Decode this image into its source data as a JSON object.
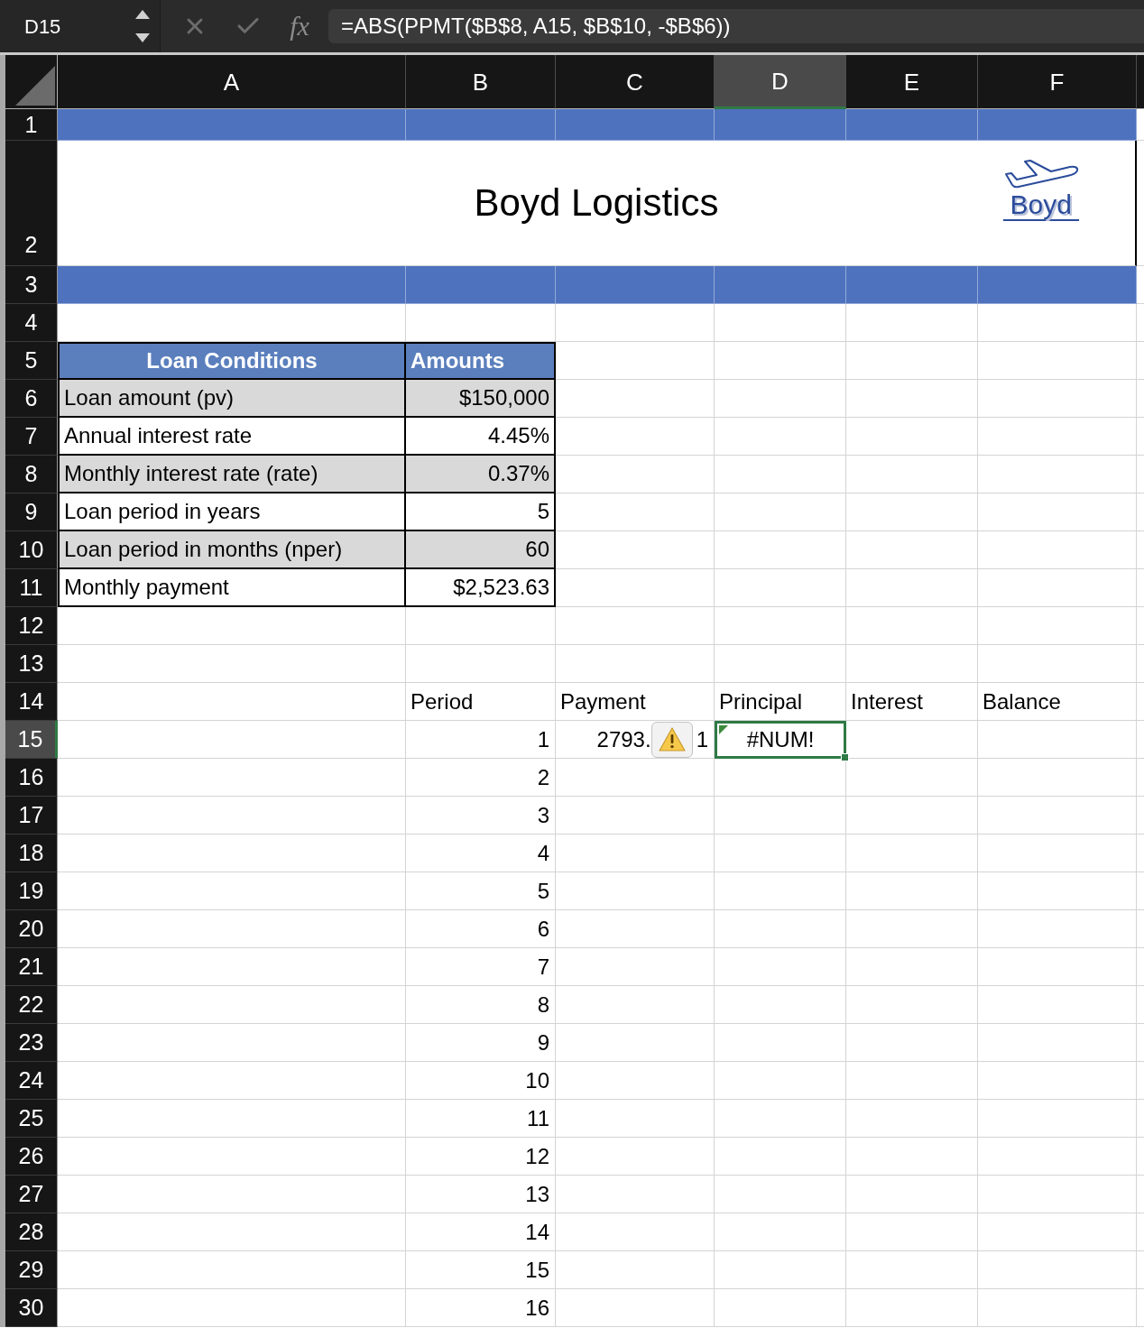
{
  "formula_bar": {
    "name_box": "D15",
    "function_label": "fx",
    "formula": "=ABS(PPMT($B$8, A15, $B$10, -$B$6))"
  },
  "columns": [
    {
      "label": "A",
      "selected": false
    },
    {
      "label": "B",
      "selected": false
    },
    {
      "label": "C",
      "selected": false
    },
    {
      "label": "D",
      "selected": true
    },
    {
      "label": "E",
      "selected": false
    },
    {
      "label": "F",
      "selected": false
    }
  ],
  "rows": [
    {
      "label": "1",
      "selected": false
    },
    {
      "label": "2",
      "selected": false
    },
    {
      "label": "3",
      "selected": false
    },
    {
      "label": "4",
      "selected": false
    },
    {
      "label": "5",
      "selected": false
    },
    {
      "label": "6",
      "selected": false
    },
    {
      "label": "7",
      "selected": false
    },
    {
      "label": "8",
      "selected": false
    },
    {
      "label": "9",
      "selected": false
    },
    {
      "label": "10",
      "selected": false
    },
    {
      "label": "11",
      "selected": false
    },
    {
      "label": "12",
      "selected": false
    },
    {
      "label": "13",
      "selected": false
    },
    {
      "label": "14",
      "selected": false
    },
    {
      "label": "15",
      "selected": true
    },
    {
      "label": "16",
      "selected": false
    },
    {
      "label": "17",
      "selected": false
    },
    {
      "label": "18",
      "selected": false
    },
    {
      "label": "19",
      "selected": false
    },
    {
      "label": "20",
      "selected": false
    },
    {
      "label": "21",
      "selected": false
    },
    {
      "label": "22",
      "selected": false
    },
    {
      "label": "23",
      "selected": false
    },
    {
      "label": "24",
      "selected": false
    },
    {
      "label": "25",
      "selected": false
    },
    {
      "label": "26",
      "selected": false
    },
    {
      "label": "27",
      "selected": false
    },
    {
      "label": "28",
      "selected": false
    },
    {
      "label": "29",
      "selected": false
    },
    {
      "label": "30",
      "selected": false
    }
  ],
  "title": "Boyd Logistics",
  "logo": {
    "text": "Boyd"
  },
  "loan_table": {
    "columns": [
      "Loan Conditions",
      "Amounts"
    ],
    "rows": [
      {
        "label": "Loan amount (pv)",
        "value": "$150,000"
      },
      {
        "label": "Annual interest rate",
        "value": "4.45%"
      },
      {
        "label": "Monthly interest rate (rate)",
        "value": "0.37%"
      },
      {
        "label": "Loan period in years",
        "value": "5"
      },
      {
        "label": "Loan period in months (nper)",
        "value": "60"
      },
      {
        "label": "Monthly payment",
        "value": "$2,523.63"
      }
    ]
  },
  "schedule": {
    "columns": [
      "Period",
      "Payment",
      "Principal",
      "Interest",
      "Balance"
    ],
    "rows": [
      {
        "period": "1",
        "payment": "2793.",
        "payment_tail": "1",
        "warning": true,
        "principal": "#NUM!",
        "error_flag": true
      },
      {
        "period": "2"
      },
      {
        "period": "3"
      },
      {
        "period": "4"
      },
      {
        "period": "5"
      },
      {
        "period": "6"
      },
      {
        "period": "7"
      },
      {
        "period": "8"
      },
      {
        "period": "9"
      },
      {
        "period": "10"
      },
      {
        "period": "11"
      },
      {
        "period": "12"
      },
      {
        "period": "13"
      },
      {
        "period": "14"
      },
      {
        "period": "15"
      },
      {
        "period": "16"
      }
    ]
  }
}
